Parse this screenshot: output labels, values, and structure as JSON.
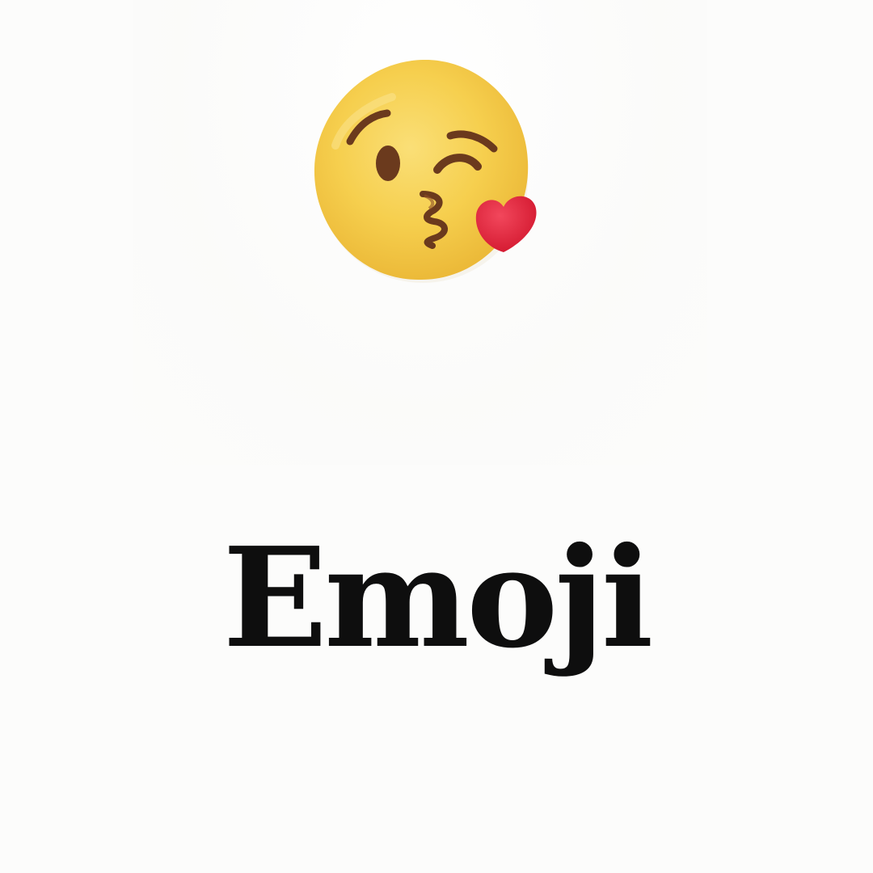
{
  "title": "Emoji",
  "illustration": {
    "icon": "face-blowing-a-kiss-icon",
    "colors": {
      "face": "#f7cf4f",
      "face_shadow": "#eab83a",
      "features": "#6b3a1d",
      "heart": "#e0243f",
      "background": "#fcfcfb",
      "title": "#0e0e0e"
    }
  }
}
